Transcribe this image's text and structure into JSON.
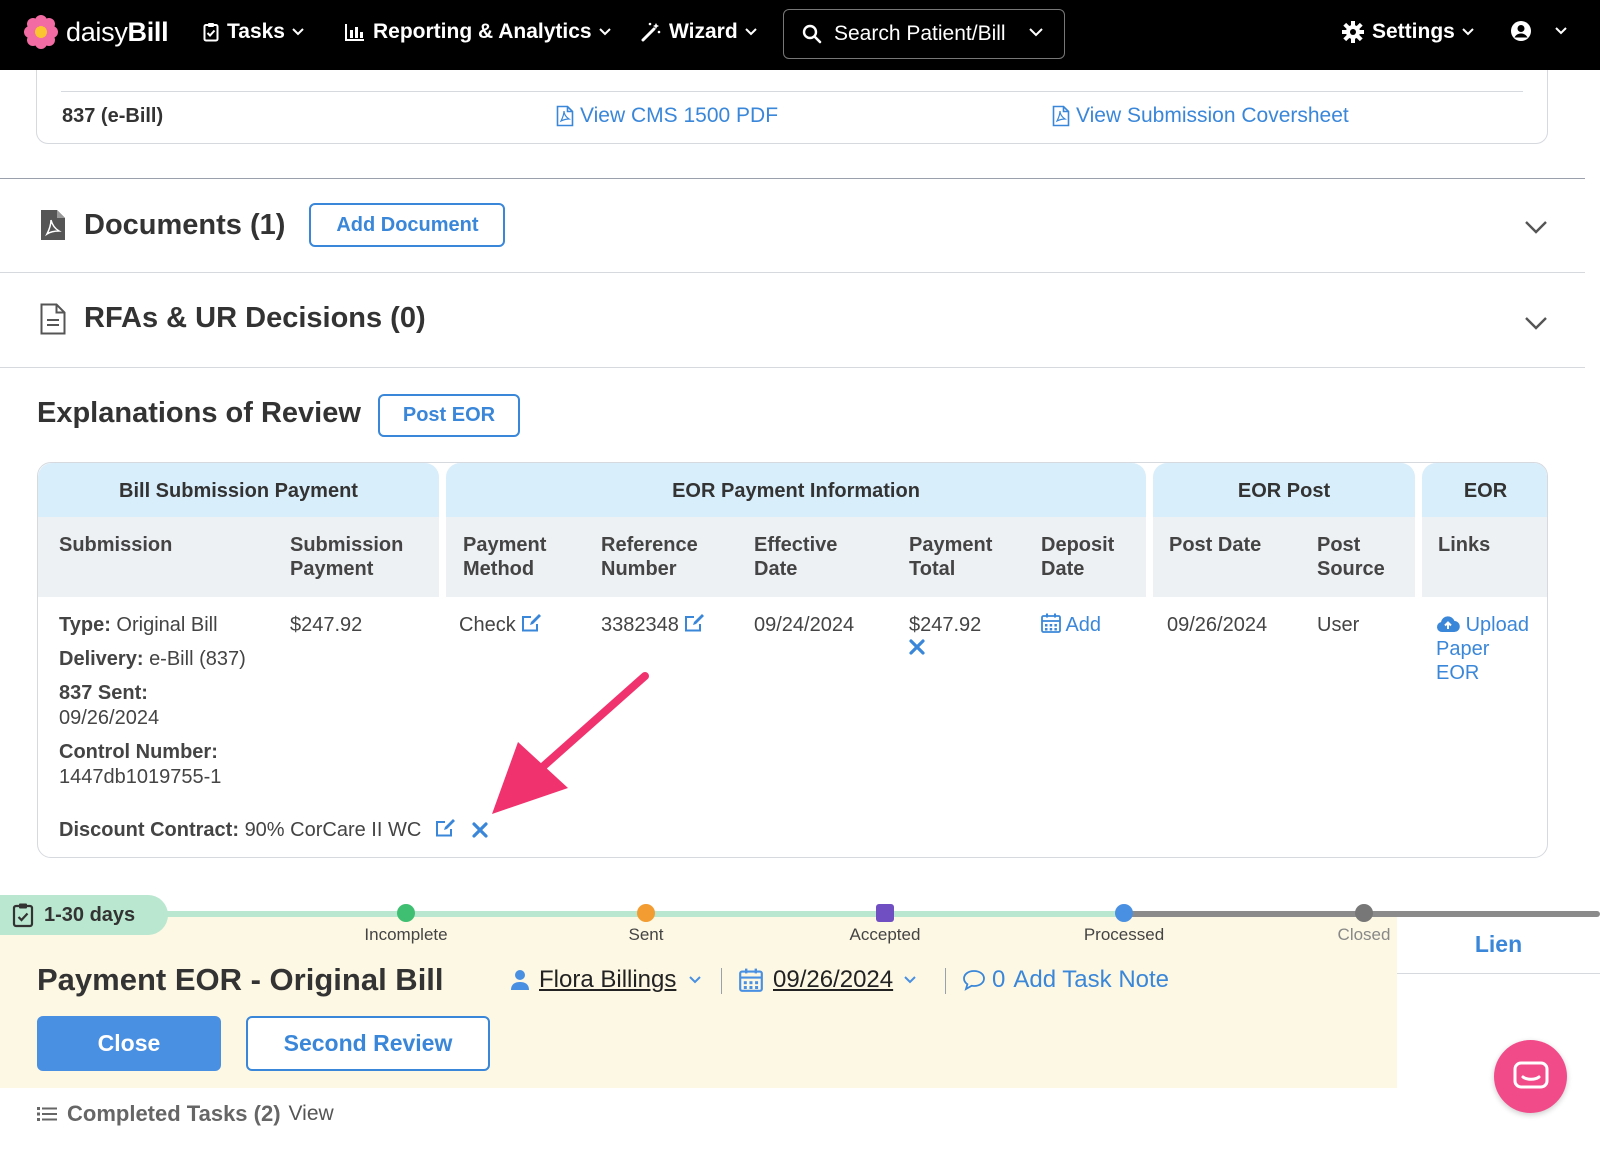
{
  "nav": {
    "brand_light": "daisy",
    "brand_bold": "Bill",
    "tasks": "Tasks",
    "reporting": "Reporting & Analytics",
    "wizard": "Wizard",
    "search_placeholder": "Search Patient/Bill",
    "settings": "Settings"
  },
  "top_card": {
    "row_label": "837 (e-Bill)",
    "link_cms": "View CMS 1500 PDF",
    "link_coversheet": "View Submission Coversheet"
  },
  "documents": {
    "title": "Documents (1)",
    "add_button": "Add Document"
  },
  "rfas": {
    "title": "RFAs & UR Decisions (0)"
  },
  "eor": {
    "title": "Explanations of Review",
    "post_button": "Post EOR",
    "groups": [
      "Bill Submission Payment",
      "EOR Payment Information",
      "EOR Post",
      "EOR"
    ],
    "columns": {
      "submission": "Submission",
      "submission_payment_1": "Submission",
      "submission_payment_2": "Payment",
      "payment_method_1": "Payment",
      "payment_method_2": "Method",
      "reference_1": "Reference",
      "reference_2": "Number",
      "effective_1": "Effective",
      "effective_2": "Date",
      "payment_total_1": "Payment",
      "payment_total_2": "Total",
      "deposit_1": "Deposit",
      "deposit_2": "Date",
      "post_date": "Post Date",
      "post_source_1": "Post",
      "post_source_2": "Source",
      "links": "Links"
    },
    "row": {
      "type_label": "Type:",
      "type_value": "Original Bill",
      "delivery_label": "Delivery:",
      "delivery_value": "e-Bill (837)",
      "sent_label": "837 Sent:",
      "sent_value": "09/26/2024",
      "control_label": "Control Number:",
      "control_value": "1447db1019755-1",
      "submission_payment": "$247.92",
      "payment_method": "Check",
      "reference_number": "3382348",
      "effective_date": "09/24/2024",
      "payment_total": "$247.92",
      "deposit_add": "Add",
      "post_date": "09/26/2024",
      "post_source": "User",
      "upload_1": "Upload",
      "upload_2": "Paper",
      "upload_3": "EOR",
      "discount_label": "Discount Contract:",
      "discount_value": "90% CorCare II WC"
    }
  },
  "task": {
    "age_badge": "1-30 days",
    "stages": [
      "Incomplete",
      "Sent",
      "Accepted",
      "Processed",
      "Closed"
    ],
    "title": "Payment EOR - Original Bill",
    "assignee": "Flora Billings",
    "due_date": "09/26/2024",
    "note_count": "0",
    "note_label": "Add Task Note",
    "close_button": "Close",
    "second_review_button": "Second Review",
    "lien_tab": "Lien",
    "completed_label": "Completed Tasks (2)",
    "completed_view": "View"
  },
  "colors": {
    "accent": "#3a87d9",
    "task_bg": "#fdf8e4",
    "group_header": "#d9eefb",
    "annotation_arrow": "#f0326e",
    "chat": "#f24b8a"
  }
}
